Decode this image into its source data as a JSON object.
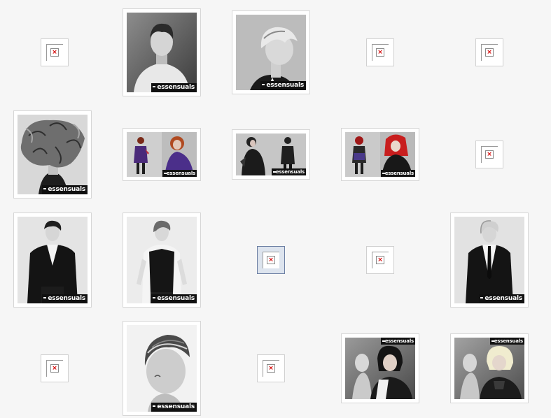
{
  "gallery": {
    "brand_label": "essensuals",
    "broken_glyph": "×",
    "items": [
      {
        "type": "broken"
      },
      {
        "type": "photo",
        "shape": "portrait",
        "subject": "young-man-white-sweater",
        "brand_pos": "bottom"
      },
      {
        "type": "photo",
        "shape": "portrait",
        "subject": "profile-cropped-blonde",
        "brand_pos": "bottom"
      },
      {
        "type": "broken"
      },
      {
        "type": "broken"
      },
      {
        "type": "photo",
        "shape": "portrait",
        "subject": "windswept-curly-hair",
        "brand_pos": "bottom"
      },
      {
        "type": "photo",
        "shape": "wide",
        "subject": "two-women-purple-red-hair",
        "brand_pos": "bottom"
      },
      {
        "type": "photo",
        "shape": "wide",
        "subject": "two-women-dark-leather",
        "brand_pos": "bottom"
      },
      {
        "type": "photo",
        "shape": "wide",
        "subject": "two-women-red-hair",
        "brand_pos": "bottom"
      },
      {
        "type": "broken"
      },
      {
        "type": "photo",
        "shape": "portrait",
        "subject": "man-black-suit",
        "brand_pos": "bottom"
      },
      {
        "type": "photo",
        "shape": "portrait",
        "subject": "man-black-waistcoat",
        "brand_pos": "bottom"
      },
      {
        "type": "broken",
        "selected": true
      },
      {
        "type": "broken"
      },
      {
        "type": "photo",
        "shape": "portrait",
        "subject": "blonde-man-black-tie",
        "brand_pos": "bottom"
      },
      {
        "type": "broken"
      },
      {
        "type": "photo",
        "shape": "portrait",
        "subject": "man-slicked-side-part",
        "brand_pos": "bottom"
      },
      {
        "type": "broken"
      },
      {
        "type": "photo",
        "shape": "wide-tall",
        "subject": "dark-bob-with-mannequin",
        "brand_pos": "top"
      },
      {
        "type": "photo",
        "shape": "wide-tall",
        "subject": "blonde-bob-with-mannequin",
        "brand_pos": "top"
      }
    ]
  }
}
